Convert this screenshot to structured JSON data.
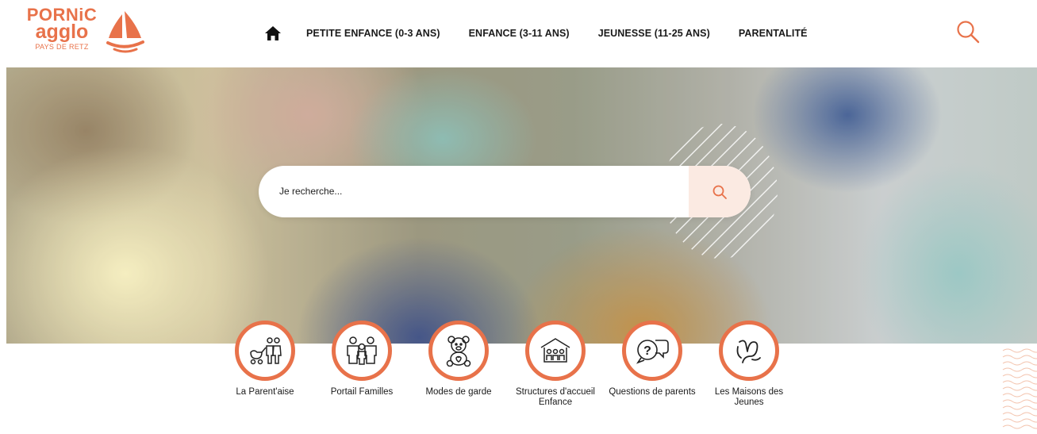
{
  "header": {
    "logo": {
      "line1": "PORNiC",
      "line2": "agglo",
      "line3": "PAYS DE RETZ"
    },
    "nav": [
      {
        "label": "PETITE ENFANCE (0-3 ANS)"
      },
      {
        "label": "ENFANCE (3-11 ANS)"
      },
      {
        "label": "JEUNESSE (11-25 ANS)"
      },
      {
        "label": "PARENTALITÉ"
      }
    ],
    "icons": {
      "home": "home-icon",
      "search": "search-icon"
    }
  },
  "hero": {
    "search": {
      "placeholder": "Je recherche..."
    }
  },
  "quick_access": [
    {
      "label": "La Parent'aise",
      "icon": "family-icon"
    },
    {
      "label": "Portail Familles",
      "icon": "family-portal-icon"
    },
    {
      "label": "Modes de garde",
      "icon": "teddy-bear-icon"
    },
    {
      "label": "Structures d'accueil Enfance",
      "icon": "childcare-building-icon"
    },
    {
      "label": "Questions de parents",
      "icon": "question-bubbles-icon"
    },
    {
      "label": "Les Maisons des Jeunes",
      "icon": "youth-house-icon"
    }
  ],
  "colors": {
    "accent": "#e8724a",
    "text": "#1a1a1a",
    "search_button_bg": "#fbeae2"
  }
}
